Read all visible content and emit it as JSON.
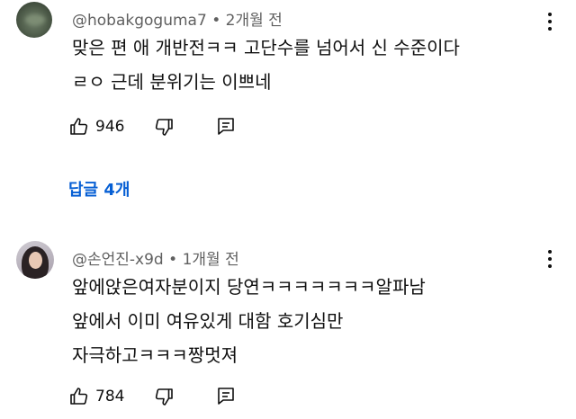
{
  "comments": [
    {
      "author": "@hobakgoguma7",
      "separator": "•",
      "time": "2개월 전",
      "lines": [
        "맞은 편 애 개반전ㅋㅋ 고단수를 넘어서 신 수준이다",
        "ㄹㅇ 근데 분위기는 이쁘네"
      ],
      "likes": "946",
      "replies_label": "답글 4개"
    },
    {
      "author": "@손언진-x9d",
      "separator": "•",
      "time": "1개월 전",
      "lines": [
        "앞에앉은여자분이지 당연ㅋㅋㅋㅋㅋㅋㅋ알파남",
        "앞에서 이미 여유있게 대함 호기심만",
        "자극하고ㅋㅋㅋ짱멋져"
      ],
      "likes": "784"
    }
  ],
  "colors": {
    "text": "#0f0f0f",
    "meta": "#606060",
    "link": "#065fd4",
    "background": "#ffffff"
  },
  "icons": [
    "thumb-up-icon",
    "thumb-down-icon",
    "reply-icon",
    "more-vert-icon"
  ]
}
